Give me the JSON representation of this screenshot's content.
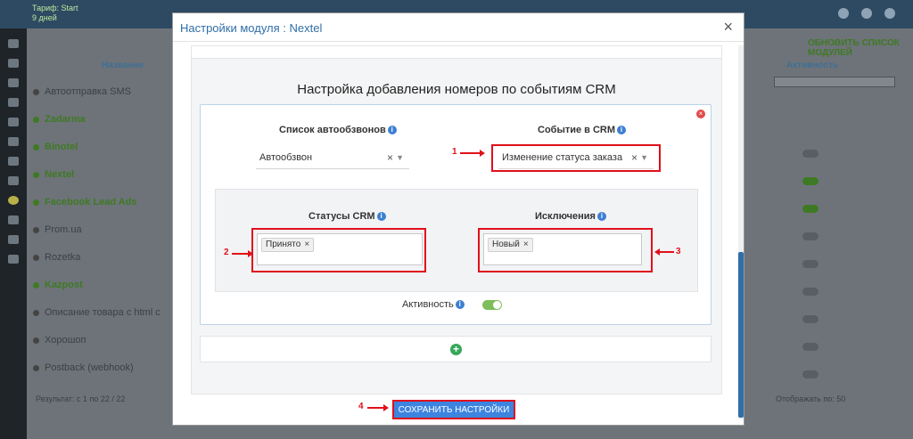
{
  "background": {
    "brand_line1": "Тариф: Start",
    "brand_line2": "9 дней",
    "col_name": "Название",
    "col_activity": "Активность",
    "refresh": "ОБНОВИТЬ СПИСОК МОДУЛЕЙ",
    "list": [
      {
        "label": "Автоотправка SMS",
        "active": false
      },
      {
        "label": "Zadarma",
        "active": true
      },
      {
        "label": "Binotel",
        "active": true
      },
      {
        "label": "Nextel",
        "active": true
      },
      {
        "label": "Facebook Lead Ads",
        "active": true
      },
      {
        "label": "Prom.ua",
        "active": false
      },
      {
        "label": "Rozetka",
        "active": false
      },
      {
        "label": "Kazpost",
        "active": true
      },
      {
        "label": "Описание товара с html c",
        "active": false
      },
      {
        "label": "Хорошоп",
        "active": false
      },
      {
        "label": "Postback (webhook)",
        "active": false
      }
    ],
    "footer_left": "Результат: с 1 по 22 / 22",
    "footer_right": "Отображать по: 50"
  },
  "modal": {
    "title": "Настройки модуля : Nextel",
    "close_glyph": "×"
  },
  "section": {
    "title": "Настройка добавления номеров по событиям CRM"
  },
  "form": {
    "autodial_label": "Список автообзвонов",
    "autodial_value": "Автообзвон",
    "crm_event_label": "Событие в CRM",
    "crm_event_value": "Изменение статуса заказа",
    "crm_status_label": "Статусы CRM",
    "crm_status_tag": "Принято",
    "exceptions_label": "Исключения",
    "exceptions_tag": "Новый",
    "activity_label": "Активность",
    "activity_on": true,
    "clear_glyph": "×",
    "caret_glyph": "▼",
    "info_glyph": "i",
    "remove_glyph": "×",
    "add_glyph": "+"
  },
  "save_button": "СОХРАНИТЬ НАСТРОЙКИ",
  "annotations": [
    "1",
    "2",
    "3",
    "4"
  ],
  "colors": {
    "accent_blue": "#3d84e0",
    "title_blue": "#2f6ea7",
    "annotation_red": "#e0101b",
    "toggle_green": "#7dbd5a"
  }
}
